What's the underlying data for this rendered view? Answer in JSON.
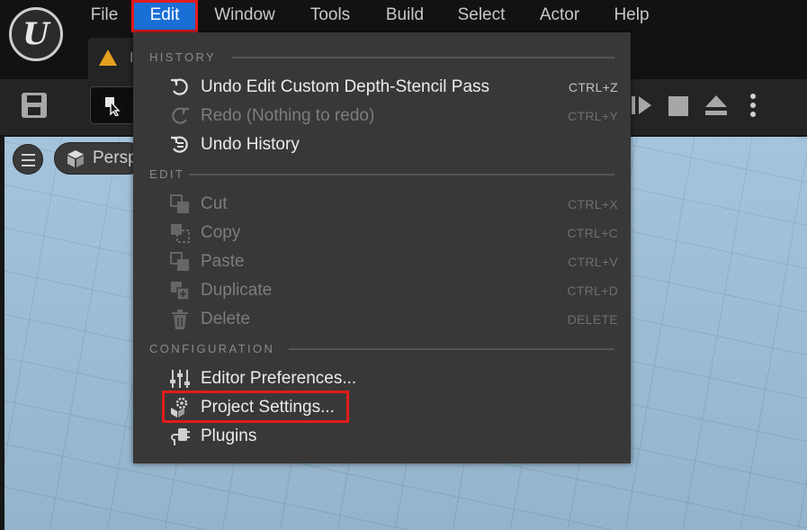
{
  "menubar": {
    "items": [
      {
        "label": "File"
      },
      {
        "label": "Edit",
        "active": true
      },
      {
        "label": "Window"
      },
      {
        "label": "Tools"
      },
      {
        "label": "Build"
      },
      {
        "label": "Select"
      },
      {
        "label": "Actor"
      },
      {
        "label": "Help"
      }
    ]
  },
  "tab": {
    "icon": "level-icon",
    "label_partial": "I"
  },
  "toolbar": {
    "select_mode_partial": "S",
    "icons": [
      "save-icon",
      "select-mode-icon",
      "skip-forward-icon",
      "stop-icon",
      "eject-icon",
      "more-options-icon"
    ]
  },
  "viewport": {
    "perspective_label": "Persp"
  },
  "edit_menu": {
    "sections": {
      "history": "HISTORY",
      "edit": "EDIT",
      "configuration": "CONFIGURATION"
    },
    "history_items": [
      {
        "label": "Undo Edit Custom Depth-Stencil Pass",
        "shortcut": "CTRL+Z",
        "enabled": true,
        "icon": "undo-icon"
      },
      {
        "label": "Redo (Nothing to redo)",
        "shortcut": "CTRL+Y",
        "enabled": false,
        "icon": "redo-icon"
      },
      {
        "label": "Undo History",
        "shortcut": "",
        "enabled": true,
        "icon": "undo-history-icon"
      }
    ],
    "edit_items": [
      {
        "label": "Cut",
        "shortcut": "CTRL+X",
        "enabled": false,
        "icon": "cut-icon"
      },
      {
        "label": "Copy",
        "shortcut": "CTRL+C",
        "enabled": false,
        "icon": "copy-icon"
      },
      {
        "label": "Paste",
        "shortcut": "CTRL+V",
        "enabled": false,
        "icon": "paste-icon"
      },
      {
        "label": "Duplicate",
        "shortcut": "CTRL+D",
        "enabled": false,
        "icon": "duplicate-icon"
      },
      {
        "label": "Delete",
        "shortcut": "DELETE",
        "enabled": false,
        "icon": "delete-icon"
      }
    ],
    "config_items": [
      {
        "label": "Editor Preferences...",
        "enabled": true,
        "icon": "sliders-icon"
      },
      {
        "label": "Project Settings...",
        "enabled": true,
        "icon": "project-settings-icon",
        "highlighted": true
      },
      {
        "label": "Plugins",
        "enabled": true,
        "icon": "plugin-icon"
      }
    ]
  },
  "colors": {
    "active_menu": "#1a6fd6",
    "highlight_border": "#e01c1c",
    "menu_bg": "#383838"
  }
}
